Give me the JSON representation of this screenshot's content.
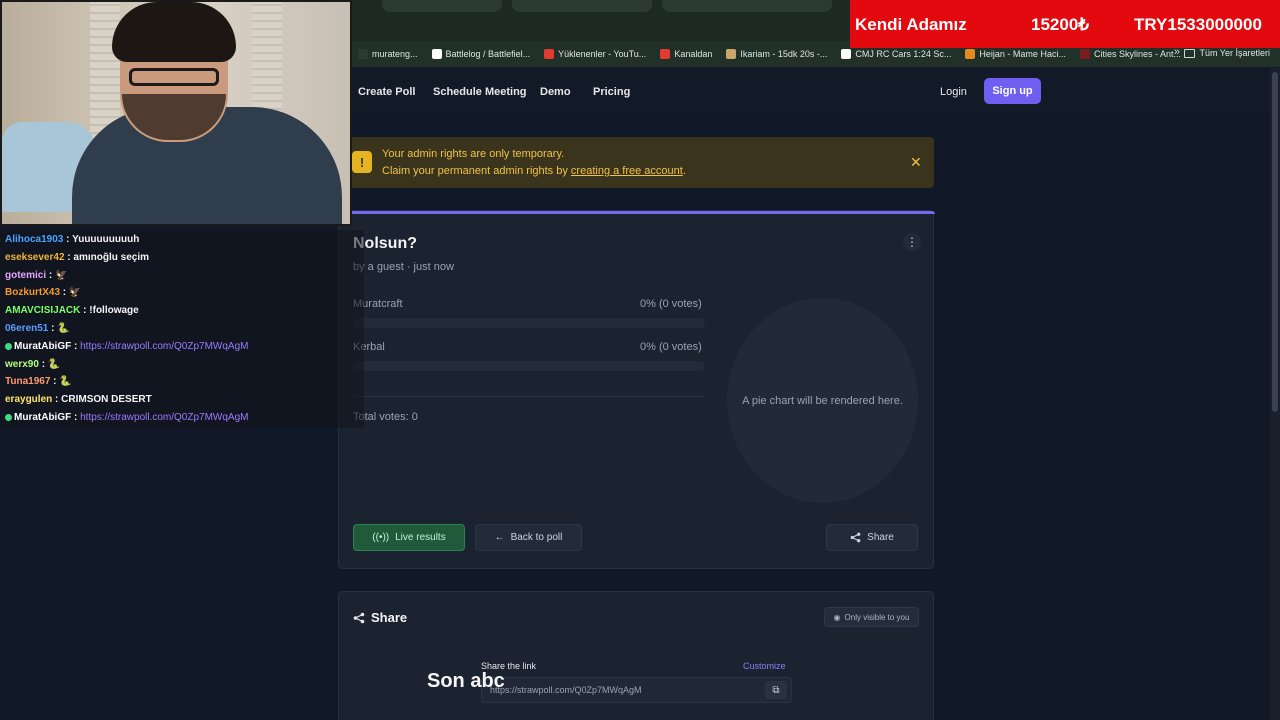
{
  "browser": {
    "bookmarks": [
      {
        "label": "murateng...",
        "color": "#2b3a33"
      },
      {
        "label": "Battlelog / Battlefiel...",
        "color": "#ffffff"
      },
      {
        "label": "Yüklenenler - YouTu...",
        "color": "#e33b2e"
      },
      {
        "label": "Kanaldan",
        "color": "#e33b2e"
      },
      {
        "label": "Ikariam - 15dk 20s -...",
        "color": "#caa66a"
      },
      {
        "label": "CMJ RC Cars 1:24 Sc...",
        "color": "#ffffff"
      },
      {
        "label": "Heijan - Mame Haci...",
        "color": "#e58a1f"
      },
      {
        "label": "Cities Skylines - Ant...",
        "color": "#7a1d1d"
      }
    ],
    "more": "»",
    "all_bookmarks": "Tüm Yer İşaretleri"
  },
  "banner": {
    "name": "Kendi Adamız",
    "amount": "15200₺",
    "total": "TRY1533000000"
  },
  "nav": {
    "links": [
      "Create Poll",
      "Schedule Meeting",
      "Demo",
      "Pricing"
    ],
    "login": "Login",
    "signup": "Sign up"
  },
  "alert": {
    "icon": "warning-icon",
    "line1": "Your admin rights are only temporary.",
    "line2_prefix": "Claim your permanent admin rights by ",
    "line2_link": "creating a free account",
    "line2_suffix": ".",
    "close": "✕"
  },
  "poll": {
    "title": "Nolsun?",
    "meta": "by a guest · just now",
    "options": [
      {
        "label": "Muratcraft",
        "result": "0% (0 votes)",
        "fraction": 0
      },
      {
        "label": "Kerbal",
        "result": "0% (0 votes)",
        "fraction": 0
      }
    ],
    "total": "Total votes: 0",
    "pie_placeholder": "A pie chart will be rendered here.",
    "buttons": {
      "live": "Live results",
      "back": "Back to poll",
      "share": "Share"
    }
  },
  "share": {
    "title": "Share",
    "visibility": "Only visible to you",
    "link_label": "Share the link",
    "customize": "Customize",
    "link": "https://strawpoll.com/Q0Zp7MWqAgM"
  },
  "chat": [
    {
      "user": "Alihoca1903",
      "color": "#4aa3ff",
      "msg": "Yuuuuuuuuuh",
      "link": false
    },
    {
      "user": "eseksever42",
      "color": "#f0b43c",
      "msg": "amınoğlu seçim",
      "link": false
    },
    {
      "user": "gotemici",
      "color": "#e5a6ff",
      "msg": "🦅",
      "link": false
    },
    {
      "user": "BozkurtX43",
      "color": "#f29a2e",
      "msg": "🦅",
      "link": false
    },
    {
      "user": "AMAVCISIJACK",
      "color": "#7dff6a",
      "msg": "!followage",
      "link": false
    },
    {
      "user": "06eren51",
      "color": "#5b9dff",
      "msg": "🐍",
      "link": false
    },
    {
      "user": "MuratAbiGF",
      "color": "#ffffff",
      "msg": "https://strawpoll.com/Q0Zp7MWqAgM",
      "link": true
    },
    {
      "user": "werx90",
      "color": "#b0ff7a",
      "msg": "🐍",
      "link": false
    },
    {
      "user": "Tuna1967",
      "color": "#ff9b6a",
      "msg": "🐍",
      "link": false
    },
    {
      "user": "eraygulen",
      "color": "#ffe76a",
      "msg": "CRIMSON DESERT",
      "link": false
    },
    {
      "user": "MuratAbiGF",
      "color": "#ffffff",
      "msg": "https://strawpoll.com/Q0Zp7MWqAgM",
      "link": true
    }
  ],
  "overlay_text": "Son abc"
}
